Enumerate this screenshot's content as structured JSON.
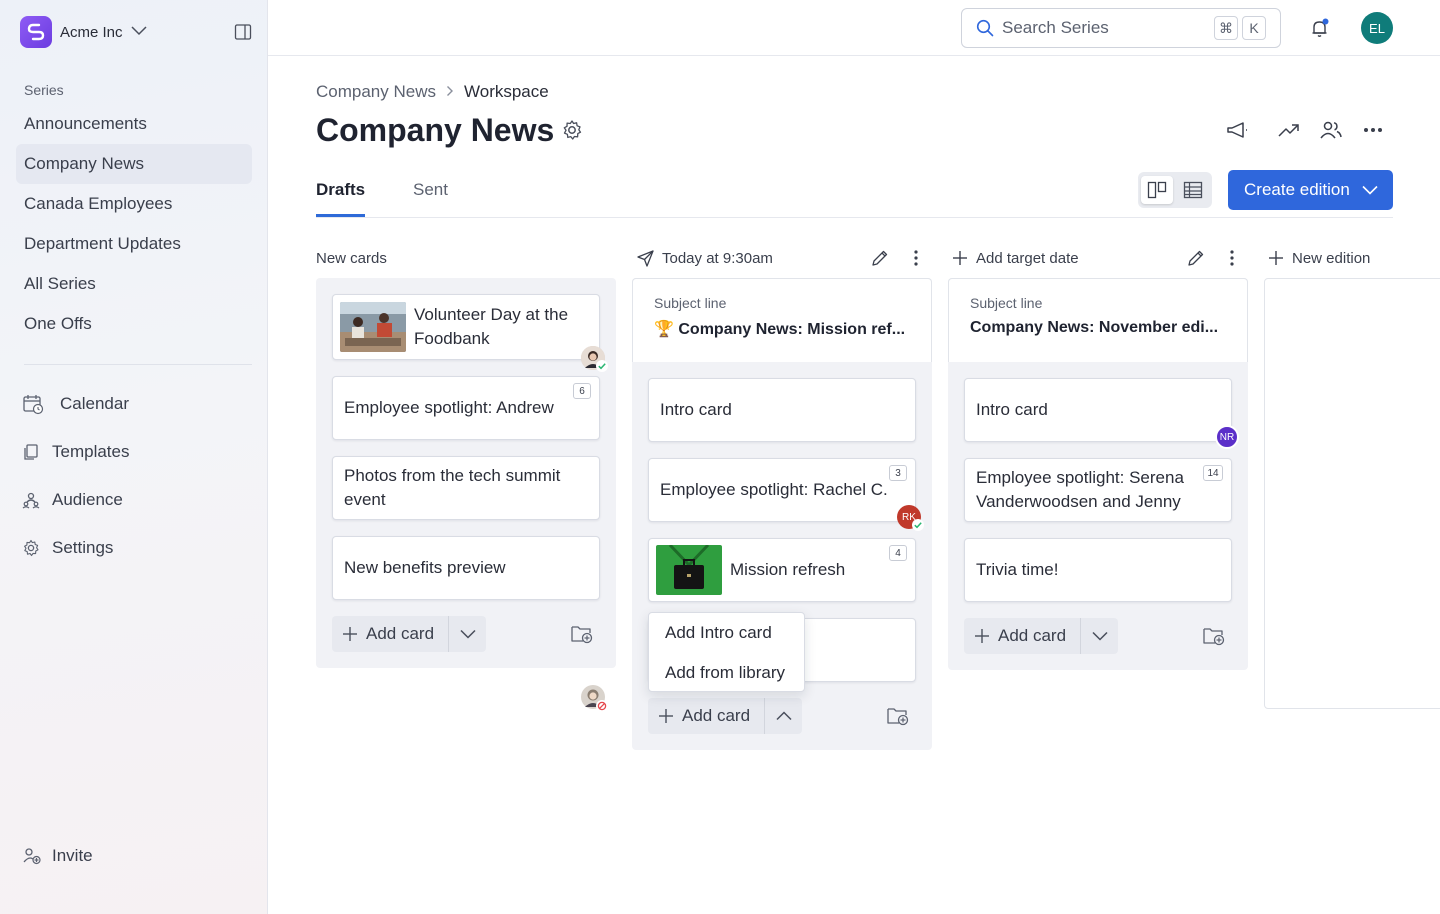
{
  "sidebar": {
    "workspace_name": "Acme Inc",
    "section_label": "Series",
    "series": [
      {
        "label": "Announcements"
      },
      {
        "label": "Company News"
      },
      {
        "label": "Canada Employees"
      },
      {
        "label": "Department Updates"
      },
      {
        "label": "All Series"
      },
      {
        "label": "One Offs"
      }
    ],
    "nav": [
      {
        "label": "Calendar",
        "icon": "calendar-icon"
      },
      {
        "label": "Templates",
        "icon": "templates-icon"
      },
      {
        "label": "Audience",
        "icon": "audience-icon"
      },
      {
        "label": "Settings",
        "icon": "gear-icon"
      }
    ],
    "invite_label": "Invite"
  },
  "topbar": {
    "search_placeholder": "Search Series",
    "shortcut_keys": [
      "⌘",
      "K"
    ],
    "user_initials": "EL"
  },
  "header": {
    "breadcrumb": [
      "Company News",
      "Workspace"
    ],
    "title": "Company News",
    "tabs": [
      {
        "label": "Drafts"
      },
      {
        "label": "Sent"
      }
    ],
    "create_button_label": "Create edition"
  },
  "columns": [
    {
      "heading": "New cards",
      "cards": [
        {
          "title": "Volunteer Day at the Foodbank",
          "has_thumbnail": true,
          "avatar_status": "approved"
        },
        {
          "title": "Employee spotlight: Andrew",
          "comment_count": "6"
        },
        {
          "title": "Photos from the tech summit event",
          "avatar_status": "rejected"
        },
        {
          "title": "New benefits preview"
        }
      ],
      "add_card_label": "Add card"
    },
    {
      "heading": "Today at 9:30am",
      "subject_label": "Subject line",
      "subject": "🏆 Company News: Mission ref...",
      "cards": [
        {
          "title": "Intro card"
        },
        {
          "title": "Employee spotlight: Rachel C.",
          "comment_count": "3",
          "avatar_initials": "RK"
        },
        {
          "title": "Mission refresh",
          "comment_count": "4",
          "has_thumbnail": true
        }
      ],
      "add_card_label": "Add card",
      "dropdown": [
        "Add Intro card",
        "Add from library"
      ]
    },
    {
      "heading": "Add target date",
      "subject_label": "Subject line",
      "subject": "Company News: November edi...",
      "cards": [
        {
          "title": "Intro card",
          "avatar_initials": "NR"
        },
        {
          "title": "Employee spotlight: Serena Vanderwoodsen and Jenny",
          "comment_count": "14"
        },
        {
          "title": "Trivia time!"
        }
      ],
      "add_card_label": "Add card"
    },
    {
      "heading": "New edition"
    }
  ],
  "colors": {
    "primary": "#2f67dc",
    "brand": "#7b4ceb",
    "user_avatar": "#0f7c7a",
    "avatar_rk": "#c0392b",
    "avatar_nr": "#5b2fc9",
    "approved": "#2bb673",
    "rejected": "#e5484d"
  }
}
